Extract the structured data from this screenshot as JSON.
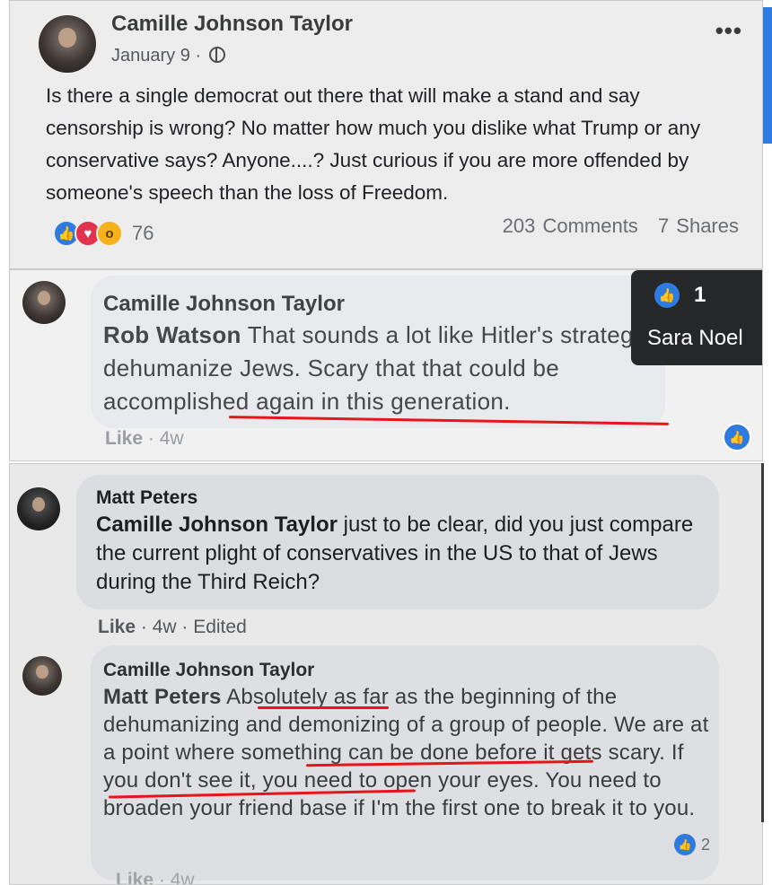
{
  "post": {
    "author": "Camille Johnson Taylor",
    "date": "January 9 ·",
    "more_label": "•••",
    "text": "Is there a single democrat out there that will make a stand and say censorship is wrong? No matter how much you dislike what Trump or any conservative says? Anyone....? Just curious if you are more offended by someone's speech than the loss of Freedom.",
    "reaction_count": "76",
    "comments": "203 Comments",
    "shares": "7 Shares"
  },
  "reply": {
    "author": "Camille Johnson Taylor",
    "mention": "Rob Watson",
    "text": "That sounds a lot like Hitler's strategy to dehumanize Jews. Scary that that could be accomplished again in this generation.",
    "meta_like": "Like",
    "meta_time": "· 4w",
    "tooltip_count": "1",
    "tooltip_name": "Sara Noel"
  },
  "matt_comment": {
    "author": "Matt Peters",
    "mention": "Camille Johnson Taylor",
    "text": "just to be clear, did you just compare the current plight of conservatives in the US to that of Jews during the Third Reich?",
    "meta_like": "Like",
    "meta_time": "· 4w · Edited"
  },
  "camille_comment": {
    "author": "Camille Johnson Taylor",
    "mention": "Matt Peters",
    "text": "Absolutely as far as the beginning of the dehumanizing and demonizing of a group of people. We are at a point where something can be done before it gets scary. If you don't see it, you need to open your eyes. You need to broaden your friend base if I'm the first one to break it to you.",
    "reaction_count": "2",
    "meta_like": "Like",
    "meta_time": "· 4w"
  },
  "colors": {
    "like_blue": "#2d7be0",
    "love_red": "#e0334d",
    "wow_yellow": "#f5b21a",
    "underline_red": "#e8141c"
  }
}
